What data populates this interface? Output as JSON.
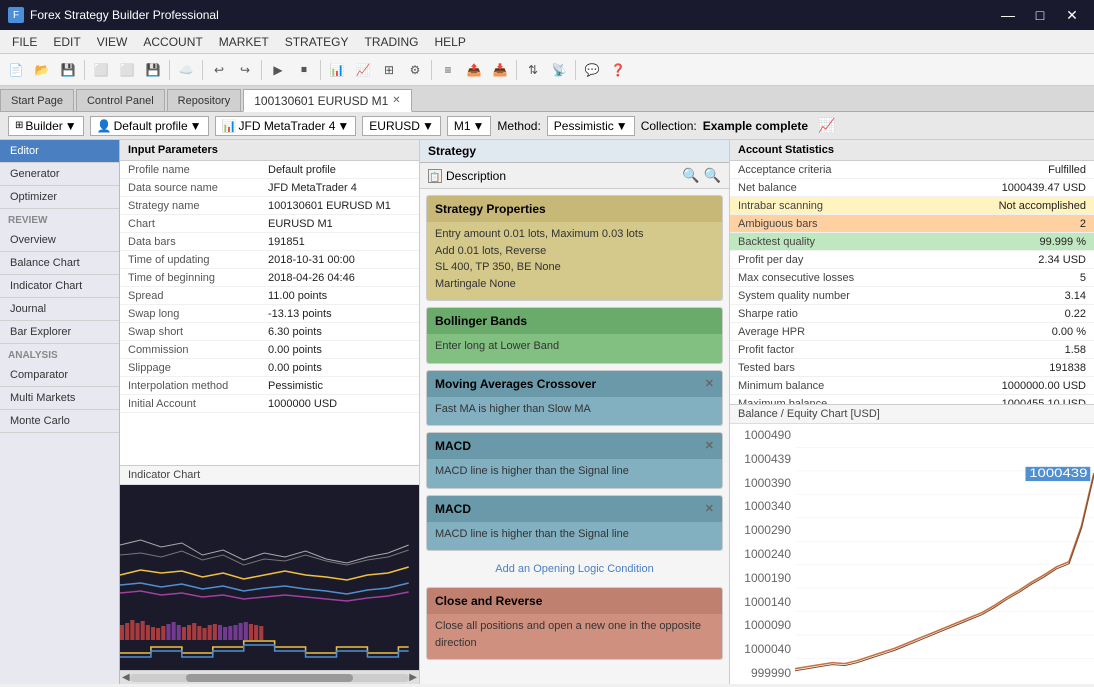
{
  "titleBar": {
    "icon": "🔧",
    "title": "Forex Strategy Builder Professional",
    "minimizeLabel": "—",
    "maximizeLabel": "□",
    "closeLabel": "✕"
  },
  "menuBar": {
    "items": [
      "FILE",
      "EDIT",
      "VIEW",
      "ACCOUNT",
      "MARKET",
      "STRATEGY",
      "TRADING",
      "HELP"
    ]
  },
  "tabs": {
    "items": [
      "Start Page",
      "Control Panel",
      "Repository",
      "100130601 EURUSD M1"
    ],
    "activeIndex": 3
  },
  "subToolbar": {
    "builderLabel": "Builder",
    "profileLabel": "Default profile",
    "brokerLabel": "JFD MetaTrader 4",
    "symbolLabel": "EURUSD",
    "periodLabel": "M1",
    "methodLabel": "Method:",
    "methodValue": "Pessimistic",
    "collectionLabel": "Collection:",
    "collectionValue": "Example complete"
  },
  "sidebar": {
    "editorLabel": "Editor",
    "generatorLabel": "Generator",
    "optimizerLabel": "Optimizer",
    "reviewLabel": "Review",
    "overviewLabel": "Overview",
    "balanceChartLabel": "Balance Chart",
    "indicatorChartLabel": "Indicator Chart",
    "journalLabel": "Journal",
    "barExplorerLabel": "Bar Explorer",
    "analysisLabel": "Analysis",
    "comparatorLabel": "Comparator",
    "multiMarketsLabel": "Multi Markets",
    "monteCarloLabel": "Monte Carlo"
  },
  "inputParams": {
    "header": "Input Parameters",
    "rows": [
      {
        "label": "Profile name",
        "value": "Default profile"
      },
      {
        "label": "Data source name",
        "value": "JFD MetaTrader 4"
      },
      {
        "label": "Strategy name",
        "value": "100130601 EURUSD M1"
      },
      {
        "label": "Chart",
        "value": "EURUSD M1"
      },
      {
        "label": "Data bars",
        "value": "191851"
      },
      {
        "label": "Time of updating",
        "value": "2018-10-31 00:00"
      },
      {
        "label": "Time of beginning",
        "value": "2018-04-26 04:46"
      },
      {
        "label": "Spread",
        "value": "11.00 points"
      },
      {
        "label": "Swap long",
        "value": "-13.13 points"
      },
      {
        "label": "Swap short",
        "value": "6.30 points"
      },
      {
        "label": "Commission",
        "value": "0.00 points"
      },
      {
        "label": "Slippage",
        "value": "0.00 points"
      },
      {
        "label": "Interpolation method",
        "value": "Pessimistic"
      },
      {
        "label": "Initial Account",
        "value": "1000000 USD"
      }
    ]
  },
  "charts": {
    "indicatorChartLabel": "Indicator Chart",
    "balanceChartLabel": "Balance Chart"
  },
  "strategy": {
    "header": "Strategy",
    "descriptionLabel": "Description",
    "cards": [
      {
        "id": "properties",
        "header": "Strategy Properties",
        "body": "Entry amount 0.01 lots, Maximum 0.03 lots\nAdd 0.01 lots, Reverse\nSL 400,  TP 350,  BE None\nMartingale  None",
        "colorClass": "card-tan",
        "bodyColorClass": "card-tan-body",
        "closable": false
      },
      {
        "id": "bollinger",
        "header": "Bollinger Bands",
        "body": "Enter long at Lower Band",
        "colorClass": "card-green",
        "bodyColorClass": "card-green-body",
        "closable": false
      },
      {
        "id": "ma-crossover",
        "header": "Moving Averages Crossover",
        "body": "Fast MA is higher than Slow MA",
        "colorClass": "card-blue",
        "bodyColorClass": "card-blue-body",
        "closable": true
      },
      {
        "id": "macd1",
        "header": "MACD",
        "body": "MACD line is higher than the Signal line",
        "colorClass": "card-blue",
        "bodyColorClass": "card-blue-body",
        "closable": true
      },
      {
        "id": "macd2",
        "header": "MACD",
        "body": "MACD line is higher than the Signal line",
        "colorClass": "card-blue",
        "bodyColorClass": "card-blue-body",
        "closable": true
      }
    ],
    "addConditionLabel": "Add an Opening Logic Condition",
    "closeAndReverse": {
      "header": "Close and Reverse",
      "body": "Close all positions and open a new one in the opposite direction",
      "colorClass": "card-coral",
      "bodyColorClass": "card-coral-body"
    }
  },
  "accountStats": {
    "header": "Account Statistics",
    "rows": [
      {
        "label": "Acceptance criteria",
        "value": "Fulfilled",
        "highlight": ""
      },
      {
        "label": "Net balance",
        "value": "1000439.47 USD",
        "highlight": ""
      },
      {
        "label": "Intrabar scanning",
        "value": "Not accomplished",
        "highlight": "yellow"
      },
      {
        "label": "Ambiguous bars",
        "value": "2",
        "highlight": "orange"
      },
      {
        "label": "Backtest quality",
        "value": "99.999 %",
        "highlight": "green"
      },
      {
        "label": "Profit per day",
        "value": "2.34 USD",
        "highlight": ""
      },
      {
        "label": "Max consecutive losses",
        "value": "5",
        "highlight": ""
      },
      {
        "label": "System quality number",
        "value": "3.14",
        "highlight": ""
      },
      {
        "label": "Sharpe ratio",
        "value": "0.22",
        "highlight": ""
      },
      {
        "label": "Average HPR",
        "value": "0.00 %",
        "highlight": ""
      },
      {
        "label": "Profit factor",
        "value": "1.58",
        "highlight": ""
      },
      {
        "label": "Tested bars",
        "value": "191838",
        "highlight": ""
      },
      {
        "label": "Minimum balance",
        "value": "1000000.00 USD",
        "highlight": ""
      },
      {
        "label": "Maximum balance",
        "value": "1000455.10 USD",
        "highlight": ""
      }
    ]
  },
  "balanceChart": {
    "header": "Balance / Equity Chart [USD]",
    "yLabels": [
      "1000490",
      "1000439",
      "1000390",
      "1000340",
      "1000290",
      "1000240",
      "1000190",
      "1000140",
      "1000090",
      "1000040",
      "999990"
    ]
  }
}
